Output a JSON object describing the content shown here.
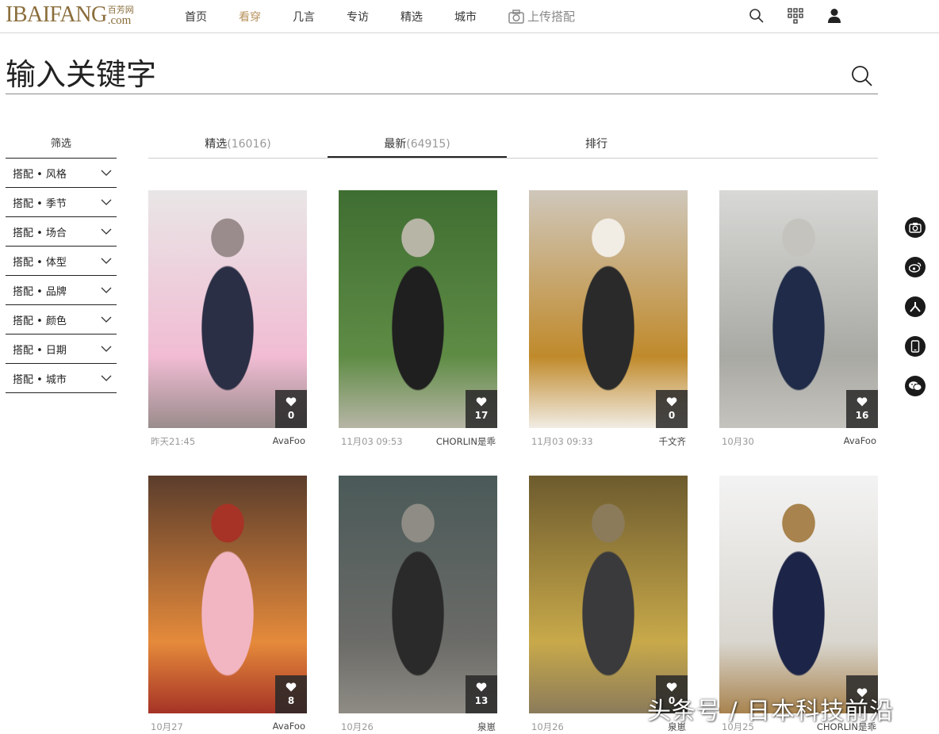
{
  "logo": {
    "main": "IBAIFANG",
    "cn": "百芳网",
    "com": ".com"
  },
  "nav": [
    {
      "label": "首页",
      "active": false
    },
    {
      "label": "看穿",
      "active": true
    },
    {
      "label": "几言",
      "active": false
    },
    {
      "label": "专访",
      "active": false
    },
    {
      "label": "精选",
      "active": false
    },
    {
      "label": "城市",
      "active": false
    }
  ],
  "upload_label": "上传搭配",
  "search": {
    "placeholder": "输入关键字"
  },
  "filter": {
    "title": "筛选",
    "items": [
      "搭配 • 风格",
      "搭配 • 季节",
      "搭配 • 场合",
      "搭配 • 体型",
      "搭配 • 品牌",
      "搭配 • 颜色",
      "搭配 • 日期",
      "搭配 • 城市"
    ]
  },
  "tabs": [
    {
      "label": "精选",
      "count": "(16016)",
      "active": false
    },
    {
      "label": "最新",
      "count": "(64915)",
      "active": true
    },
    {
      "label": "排行",
      "count": "",
      "active": false
    }
  ],
  "posts": [
    {
      "likes": "0",
      "time": "昨天21:45",
      "author": "AvaFoo",
      "palette": [
        "#e9e6e6",
        "#f1bcd3",
        "#2b2f45",
        "#9a8c8c"
      ]
    },
    {
      "likes": "17",
      "time": "11月03 09:53",
      "author": "CHORLIN是乖",
      "palette": [
        "#3f6e32",
        "#5f8c45",
        "#1f1f1f",
        "#b7b5a6"
      ]
    },
    {
      "likes": "0",
      "time": "11月03 09:33",
      "author": "千文齐",
      "palette": [
        "#cfc7bb",
        "#c08a2b",
        "#2a2a2a",
        "#f1ece4"
      ]
    },
    {
      "likes": "16",
      "time": "10月30",
      "author": "AvaFoo",
      "palette": [
        "#d8d8d6",
        "#a9a9a4",
        "#1f2b48",
        "#c5c3bd"
      ]
    },
    {
      "likes": "8",
      "time": "10月27",
      "author": "AvaFoo",
      "palette": [
        "#5b3d2c",
        "#e58a3b",
        "#f2b6c3",
        "#a63326"
      ]
    },
    {
      "likes": "13",
      "time": "10月26",
      "author": "泉崽",
      "palette": [
        "#4a5a58",
        "#6b6b68",
        "#2a2a2a",
        "#8e8c84"
      ]
    },
    {
      "likes": "0",
      "time": "10月26",
      "author": "泉崽",
      "palette": [
        "#6d5b2e",
        "#c8a94a",
        "#3a3a3c",
        "#8b7b5a"
      ]
    },
    {
      "likes": "",
      "time": "10月25",
      "author": "CHORLIN是乖",
      "palette": [
        "#f3f3f3",
        "#d9d6cf",
        "#1c2548",
        "#a8834e"
      ]
    }
  ],
  "share_icons": [
    "camera-icon",
    "weibo-icon",
    "renren-icon",
    "mobile-icon",
    "wechat-icon"
  ],
  "watermark": "头条号 / 日本科技前沿",
  "colors": {
    "accent": "#b8925e",
    "like_bg": "#282828"
  }
}
